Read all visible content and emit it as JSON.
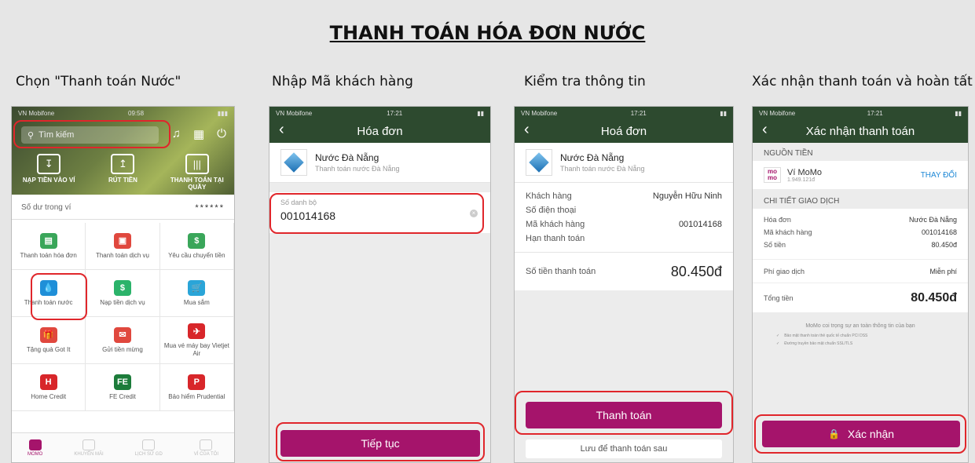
{
  "title": "THANH TOÁN HÓA ĐƠN NƯỚC",
  "captions": [
    "Chọn \"Thanh toán Nước\"",
    "Nhập Mã khách hàng",
    "Kiểm tra thông tin",
    "Xác nhận thanh toán và hoàn tất"
  ],
  "colors": {
    "primary_green": "#2d4a2f",
    "momo_pink": "#a5146b",
    "highlight_red": "#e0262b",
    "background": "#e6e6e6"
  },
  "screen1": {
    "carrier": "VN Mobifone",
    "time": "09:58",
    "search_placeholder": "Tìm kiếm",
    "top_icons": [
      "bell-icon",
      "qr-code-icon",
      "power-icon"
    ],
    "actions": [
      {
        "label": "NẠP TIỀN VÀO VÍ",
        "icon": "deposit-icon"
      },
      {
        "label": "RÚT TIỀN",
        "icon": "withdraw-icon"
      },
      {
        "label": "THANH TOÁN TẠI QUẦY",
        "icon": "barcode-icon"
      }
    ],
    "balance_label": "Số dư trong ví",
    "balance_value": "******",
    "services": [
      {
        "label": "Thanh toán hóa đơn",
        "icon": "bill-icon",
        "color": "#3aa65a"
      },
      {
        "label": "Thanh toán dịch vụ",
        "icon": "payment-icon",
        "color": "#e0483e"
      },
      {
        "label": "Yêu cầu chuyển tiền",
        "icon": "transfer-icon",
        "color": "#3aa65a"
      },
      {
        "label": "Thanh toán nước",
        "icon": "water-drop-icon",
        "color": "#1f8fd8"
      },
      {
        "label": "Nạp tiền dịch vụ",
        "icon": "dollar-icon",
        "color": "#2bb36a"
      },
      {
        "label": "Mua sắm",
        "icon": "cart-icon",
        "color": "#2aa5d8"
      },
      {
        "label": "Tặng quà Got It",
        "icon": "gift-icon",
        "color": "#e0483e"
      },
      {
        "label": "Gửi tiền mừng",
        "icon": "envelope-icon",
        "color": "#e0483e"
      },
      {
        "label": "Mua vé máy bay Vietjet Air",
        "icon": "plane-icon",
        "color": "#d8262a"
      },
      {
        "label": "Home Credit",
        "icon": "home-credit-icon",
        "color": "#d8262a"
      },
      {
        "label": "FE Credit",
        "icon": "fe-credit-icon",
        "color": "#1c7c3a"
      },
      {
        "label": "Bảo hiểm Prudential",
        "icon": "prudential-icon",
        "color": "#d8262a"
      }
    ],
    "tabs": [
      {
        "label": "MOMO",
        "active": true
      },
      {
        "label": "KHUYẾN MÃI",
        "active": false
      },
      {
        "label": "LỊCH SỬ GD",
        "active": false
      },
      {
        "label": "VÍ CỦA TÔI",
        "active": false
      }
    ]
  },
  "screen2": {
    "carrier": "VN Mobifone",
    "time": "17:21",
    "nav_title": "Hóa đơn",
    "merchant_name": "Nước Đà Nẵng",
    "merchant_sub": "Thanh toán nước Đà Nẵng",
    "field_label": "Số danh bộ",
    "field_value": "001014168",
    "continue_button": "Tiếp tục"
  },
  "screen3": {
    "carrier": "VN Mobifone",
    "time": "17:21",
    "nav_title": "Hoá đơn",
    "merchant_name": "Nước Đà Nẵng",
    "merchant_sub": "Thanh toán nước Đà Nẵng",
    "rows": [
      {
        "label": "Khách hàng",
        "value": "Nguyễn Hữu Ninh"
      },
      {
        "label": "Số điện thoại",
        "value": ""
      },
      {
        "label": "Mã khách hàng",
        "value": "001014168"
      },
      {
        "label": "Hạn thanh toán",
        "value": ""
      }
    ],
    "amount_label": "Số tiền thanh toán",
    "amount_value": "80.450đ",
    "pay_button": "Thanh toán",
    "save_later": "Lưu để thanh toán sau"
  },
  "screen4": {
    "carrier": "VN Mobifone",
    "time": "17:21",
    "nav_title": "Xác nhận thanh toán",
    "source_header": "NGUỒN TIỀN",
    "wallet_logo": "mo mo",
    "wallet_name": "Ví MoMo",
    "wallet_balance": "1.949.121đ",
    "change_label": "THAY ĐỔI",
    "detail_header": "CHI TIẾT GIAO DỊCH",
    "rows": [
      {
        "label": "Hóa đơn",
        "value": "Nước Đà Nẵng"
      },
      {
        "label": "Mã khách hàng",
        "value": "001014168"
      },
      {
        "label": "Số tiền",
        "value": "80.450đ"
      }
    ],
    "fee_label": "Phí giao dịch",
    "fee_value": "Miễn phí",
    "total_label": "Tổng tiền",
    "total_value": "80.450đ",
    "security_title": "MoMo coi trọng sự an toàn thông tin của bạn",
    "security_items": [
      "Bảo mật thanh toán thẻ quốc tế chuẩn PCI DSS",
      "Đường truyền bảo mật chuẩn SSL/TLS"
    ],
    "confirm_button": "Xác nhận"
  }
}
